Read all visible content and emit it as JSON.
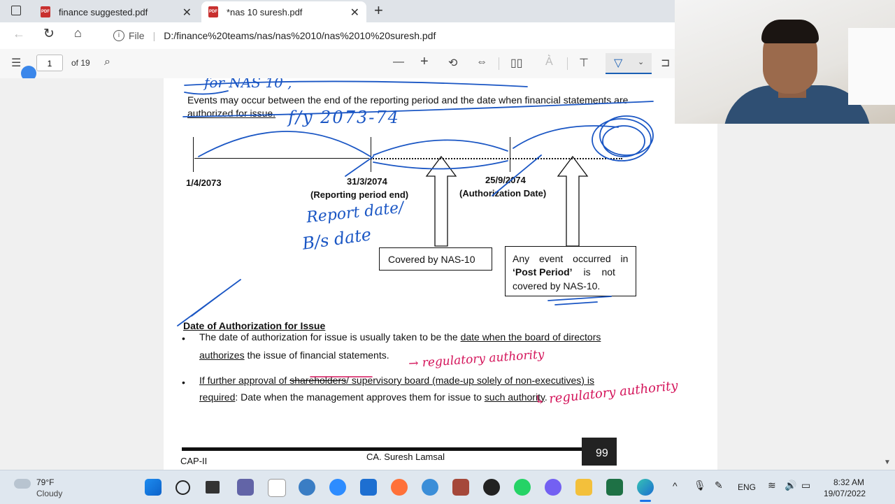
{
  "browser": {
    "tabs": [
      {
        "label": "finance suggested.pdf"
      },
      {
        "label": "*nas 10 suresh.pdf"
      }
    ],
    "file_label": "File",
    "url": "D:/finance%20teams/nas/nas%2010/nas%2010%20suresh.pdf"
  },
  "pdf_toolbar": {
    "page_number": "1",
    "page_total": "of 19"
  },
  "document": {
    "intro_line1": "Events may occur between the end of the reporting period and the date when financial statements are",
    "intro_line2": "authorized for issue.",
    "timeline": {
      "start_date": "1/4/2073",
      "report_date": "31/3/2074",
      "report_label": "(Reporting period end)",
      "auth_date": "25/9/2074",
      "auth_label": "(Authorization Date)"
    },
    "box_covered": "Covered by NAS-10",
    "box_post_prefix": "Any event occurred in",
    "box_post_bold": "‘Post Period’",
    "box_post_mid": " is not",
    "box_post_line3": "covered by NAS-10.",
    "section_title": "Date of Authorization for Issue",
    "bullet1_a": "The date of authorization for issue is usually taken to be the",
    "bullet1_u": "date when the board of directors",
    "bullet1_b_u": "authorizes",
    "bullet1_b": " the issue of financial statements.",
    "bullet2_a": "If further approval of",
    "bullet2_strike": "shareholders",
    "bullet2_b": "/ supervisory board (made-up solely of non-executives) is",
    "bullet2_c_u": "required",
    "bullet2_c": ": Date when the management approves them for issue to",
    "bullet2_c_u2": "such authority",
    "bullet2_c_end": ".",
    "footer_left": "CAP-II",
    "footer_center": "CA. Suresh Lamsal",
    "footer_page": "99"
  },
  "annotations": {
    "top_scribble": "for NAS 10 ,",
    "fy": "f/y 2073-74",
    "report_date_note1": "Report date/",
    "report_date_note2": "B/s date",
    "regulatory1": "→ regulatory authority",
    "regulatory2": "↳ regulatory authority",
    "ink_blue": "#1a56c4",
    "ink_red": "#d4145a"
  },
  "taskbar": {
    "weather_temp": "79°F",
    "weather_desc": "Cloudy",
    "lang": "ENG",
    "time": "8:32 AM",
    "date": "19/07/2022"
  }
}
